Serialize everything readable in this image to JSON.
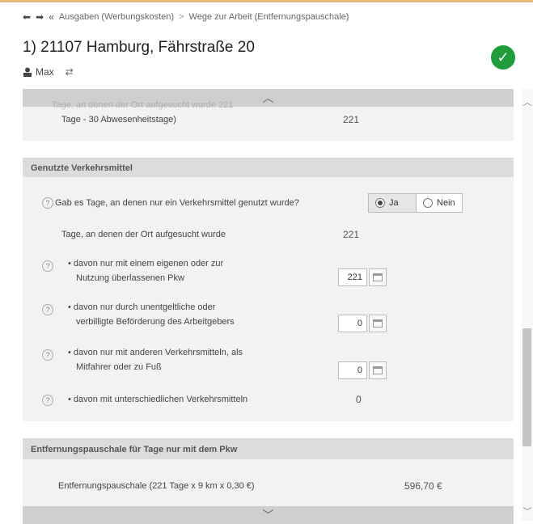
{
  "nav": {
    "back": "⬅",
    "forward": "➡",
    "double": "«",
    "crumb1": "Ausgaben (Werbungskosten)",
    "separator": ">",
    "crumb2": "Wege zur Arbeit (Entfernungspauschale)"
  },
  "header": {
    "title": "1) 21107 Hamburg, Fährstraße 20",
    "user": "Max",
    "swap_icon": "⇄",
    "status_icon": "✓"
  },
  "section_top": {
    "ghost_text": "Tage, an denen der Ort aufgesucht wurde  221",
    "label": "Tage - 30 Abwesenheitstage)",
    "value": "221"
  },
  "section_verkehr": {
    "heading": "Genutzte Verkehrsmittel",
    "question": "Gab es Tage, an denen nur ein Verkehrsmittel genutzt wurde?",
    "yes": "Ja",
    "no": "Nein",
    "days_label": "Tage, an denen der Ort aufgesucht wurde",
    "days_value": "221",
    "row1_line1": "• davon nur mit einem eigenen oder zur",
    "row1_line2": "Nutzung überlassenen Pkw",
    "row1_value": "221",
    "row2_line1": "• davon nur durch unentgeltliche oder",
    "row2_line2": "verbilligte Beförderung des Arbeitgebers",
    "row2_value": "0",
    "row3_line1": "• davon nur mit anderen Verkehrsmitteln, als",
    "row3_line2": "Mitfahrer oder zu Fuß",
    "row3_value": "0",
    "row4_label": "• davon mit unterschiedlichen Verkehrsmitteln",
    "row4_value": "0"
  },
  "section_pauschale": {
    "heading": "Entfernungspauschale für Tage nur mit dem Pkw",
    "label": "Entfernungspauschale (221 Tage x 9 km x 0,30 €)",
    "value": "596,70 €"
  },
  "scroll": {
    "up": "︿",
    "down": "﹀",
    "hint_up": "︿",
    "hint_down": "﹀"
  },
  "help_glyph": "?"
}
